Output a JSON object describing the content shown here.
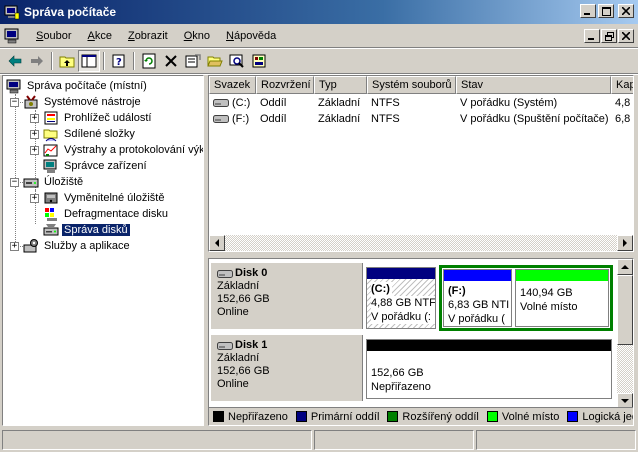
{
  "window": {
    "title": "Správa počítače"
  },
  "menu": {
    "items": [
      {
        "label": "Soubor",
        "key": "S",
        "rest": "oubor"
      },
      {
        "label": "Akce",
        "key": "A",
        "rest": "kce"
      },
      {
        "label": "Zobrazit",
        "key": "Z",
        "rest": "obrazit"
      },
      {
        "label": "Okno",
        "key": "O",
        "rest": "kno"
      },
      {
        "label": "Nápověda",
        "key": "N",
        "rest": "ápověda"
      }
    ]
  },
  "toolbar": {
    "icons": [
      "back-arrow-icon",
      "forward-arrow-icon",
      "up-folder-icon",
      "show-hide-tree-icon",
      "properties-help-icon",
      "refresh-icon",
      "delete-icon",
      "properties-icon",
      "open-folder-icon",
      "search-icon",
      "export-list-icon"
    ]
  },
  "tree": {
    "root": "Správa počítače (místní)",
    "system_tools": "Systémové nástroje",
    "event_viewer": "Prohlížeč událostí",
    "shared_folders": "Sdílené složky",
    "alerts": "Výstrahy a protokolování výk",
    "device_manager": "Správce zařízení",
    "storage": "Úložiště",
    "removable_storage": "Vyměnitelné úložiště",
    "defrag": "Defragmentace disku",
    "disk_management": "Správa disků",
    "services": "Služby a aplikace"
  },
  "volume_list": {
    "columns": [
      "Svazek",
      "Rozvržení",
      "Typ",
      "Systém souborů",
      "Stav",
      "Kap"
    ],
    "rows": [
      [
        "(C:)",
        "Oddíl",
        "Základní",
        "NTFS",
        "V pořádku (Systém)",
        "4,8"
      ],
      [
        "(F:)",
        "Oddíl",
        "Základní",
        "NTFS",
        "V pořádku (Spuštění počítače)",
        "6,8"
      ]
    ]
  },
  "disks": [
    {
      "name": "Disk 0",
      "type": "Základní",
      "size": "152,66 GB",
      "status": "Online",
      "partitions": [
        {
          "label": "(C:)",
          "size": "4,88 GB NTF",
          "state": "V pořádku (:",
          "bar_color": "#000080"
        },
        {
          "label": "(F:)",
          "size": "6,83 GB NTI",
          "state": "V pořádku (",
          "bar_color": "#0000ff"
        },
        {
          "label": "",
          "size": "140,94 GB",
          "state": "Volné místo",
          "bar_color": "#00ff00"
        }
      ]
    },
    {
      "name": "Disk 1",
      "type": "Základní",
      "size": "152,66 GB",
      "status": "Online",
      "partitions": [
        {
          "label": "",
          "size": "152,66 GB",
          "state": "Nepřiřazeno",
          "bar_color": "#000000"
        }
      ]
    }
  ],
  "legend": [
    {
      "label": "Nepřiřazeno",
      "color": "#000000"
    },
    {
      "label": "Primární oddíl",
      "color": "#000080"
    },
    {
      "label": "Rozšířený oddíl",
      "color": "#008000"
    },
    {
      "label": "Volné místo",
      "color": "#00ff00"
    },
    {
      "label": "Logická jedn",
      "color": "#0000ff"
    }
  ],
  "colors": {
    "title_bar": "#0a246a",
    "selection": "#0a246a",
    "extended_partition": "#008000"
  }
}
